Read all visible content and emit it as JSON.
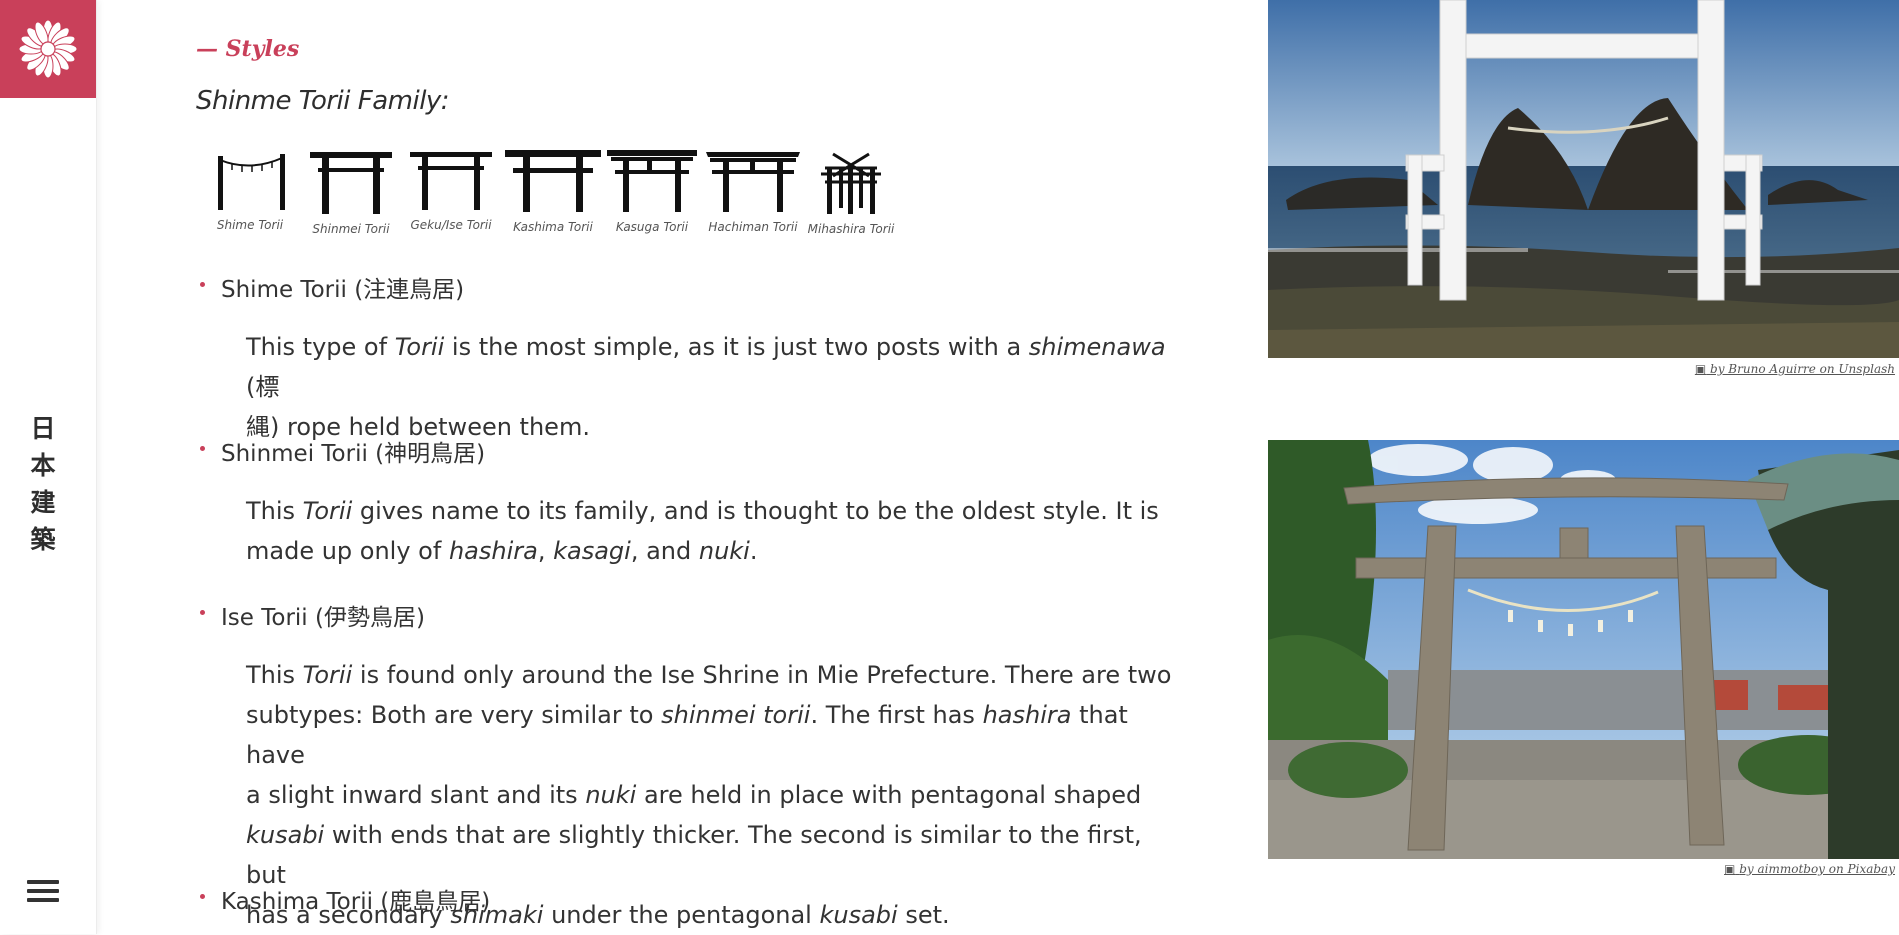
{
  "brand": {
    "logo_icon": "chrysanthemum-icon",
    "accent_color": "#c9405a"
  },
  "sidebar": {
    "vertical_title": [
      "日",
      "本",
      "建",
      "築"
    ],
    "menu_icon": "hamburger-menu-icon"
  },
  "section": {
    "label": "— Styles",
    "heading": "Shinme Torii Family:"
  },
  "torii_types": [
    "Shime Torii",
    "Shinmei Torii",
    "Geku/Ise Torii",
    "Kashima Torii",
    "Kasuga Torii",
    "Hachiman Torii",
    "Mihashira Torii"
  ],
  "items": [
    {
      "title": "Shime Torii (注連鳥居)",
      "lines": [
        [
          "This type of ",
          {
            "i": "Torii"
          },
          " is the most simple, as it is just two posts with a ",
          {
            "i": "shimenawa"
          },
          " (標"
        ],
        [
          "縄) rope held between them."
        ]
      ]
    },
    {
      "title": "Shinmei Torii (神明鳥居)",
      "lines": [
        [
          "This ",
          {
            "i": "Torii"
          },
          " gives name to its family, and is thought to be the oldest style. It is"
        ],
        [
          "made up only of ",
          {
            "i": "hashira"
          },
          ", ",
          {
            "i": "kasagi"
          },
          ", and ",
          {
            "i": "nuki"
          },
          "."
        ]
      ]
    },
    {
      "title": "Ise Torii (伊勢鳥居)",
      "lines": [
        [
          "This ",
          {
            "i": "Torii"
          },
          " is found only around the Ise Shrine in Mie Prefecture. There are two"
        ],
        [
          "subtypes: Both are very similar to ",
          {
            "i": "shinmei torii"
          },
          ". The first has ",
          {
            "i": "hashira"
          },
          " that have"
        ],
        [
          "a slight inward slant and its ",
          {
            "i": "nuki"
          },
          " are held in place with pentagonal shaped"
        ],
        [
          {
            "i": "kusabi"
          },
          " with ends that are slightly thicker. The second is similar to the first, but"
        ],
        [
          "has a secondary ",
          {
            "i": "shimaki"
          },
          " under the pentagonal ",
          {
            "i": "kusabi"
          },
          " set."
        ]
      ]
    },
    {
      "title": "Kashima Torii (鹿島鳥居)",
      "lines": []
    }
  ],
  "photos": [
    {
      "credit": "by Bruno Aguirre on Unsplash",
      "credit_icon": "camera-icon"
    },
    {
      "credit": "by aimmotboy on Pixabay",
      "credit_icon": "camera-icon"
    }
  ]
}
